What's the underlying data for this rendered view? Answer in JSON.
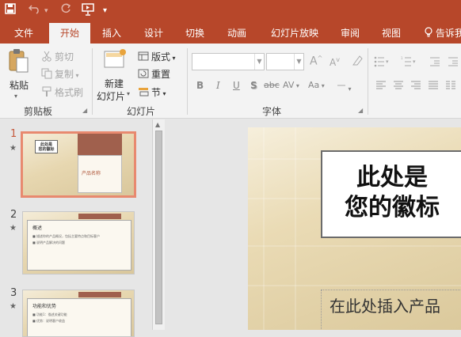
{
  "quick_access": {
    "save_icon": "save-icon",
    "undo_icon": "undo-icon",
    "redo_icon": "redo-icon",
    "present_icon": "present-icon",
    "customize_icon": "chevron-down-icon"
  },
  "tabs": [
    {
      "label": "文件"
    },
    {
      "label": "开始",
      "active": true
    },
    {
      "label": "插入"
    },
    {
      "label": "设计"
    },
    {
      "label": "切换"
    },
    {
      "label": "动画"
    },
    {
      "label": "幻灯片放映"
    },
    {
      "label": "审阅"
    },
    {
      "label": "视图"
    },
    {
      "label": "告诉我"
    }
  ],
  "ribbon": {
    "clipboard": {
      "paste": "粘贴",
      "cut": "剪切",
      "copy": "复制",
      "format_painter": "格式刷",
      "group": "剪贴板"
    },
    "slides": {
      "new_slide_line1": "新建",
      "new_slide_line2": "幻灯片",
      "layout": "版式",
      "reset": "重置",
      "section": "节",
      "group": "幻灯片"
    },
    "font": {
      "bold": "B",
      "italic": "I",
      "underline": "U",
      "shadow": "S",
      "strike": "abc",
      "spacing": "AV",
      "case": "Aa",
      "grow": "A",
      "shrink": "A",
      "group": "字体"
    }
  },
  "slides_panel": [
    {
      "number": "1",
      "star": "★",
      "logo_line1": "此处是",
      "logo_line2": "您的徽标",
      "product": "产品名称",
      "selected": true
    },
    {
      "number": "2",
      "star": "★",
      "title": "概述",
      "bullet1": "■ 描述你的产品概况，包括主要特点和目标客户",
      "bullet2": "■ 说明产品解决的问题"
    },
    {
      "number": "3",
      "star": "★",
      "title": "功能和优势",
      "bullet1": "■ 功能1：描述关键功能",
      "bullet2": "■ 优势：说明客户收益"
    }
  ],
  "main_slide": {
    "logo_line1": "此处是",
    "logo_line2": "您的徽标",
    "product_placeholder": "在此处插入产品"
  },
  "colors": {
    "accent": "#b7472a",
    "selection": "#e8896f",
    "slide_bg": "#eadbb5"
  }
}
